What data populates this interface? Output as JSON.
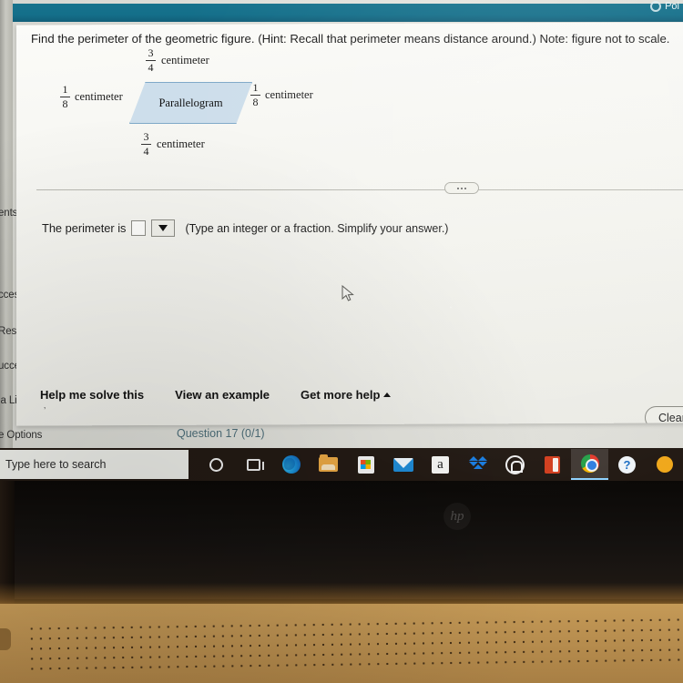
{
  "app": {
    "banner_label": "Poi",
    "banner_color": "#16738d"
  },
  "sidebar": {
    "items": [
      {
        "label": "ents"
      },
      {
        "label": "ccess"
      },
      {
        "label": "Resourc"
      },
      {
        "label": "uccess"
      },
      {
        "label": "ia Library"
      },
      {
        "label": "e Options"
      }
    ]
  },
  "exercise": {
    "prompt": "Find the perimeter of the geometric figure. (Hint: Recall that perimeter means distance around.) Note: figure not to scale.",
    "figure": {
      "shape_label": "Parallelogram",
      "top": {
        "numerator": "3",
        "denominator": "4",
        "unit": "centimeter"
      },
      "bottom": {
        "numerator": "3",
        "denominator": "4",
        "unit": "centimeter"
      },
      "left": {
        "numerator": "1",
        "denominator": "8",
        "unit": "centimeter"
      },
      "right": {
        "numerator": "1",
        "denominator": "8",
        "unit": "centimeter"
      },
      "fill_color": "#cddeeb",
      "border_color": "#7fa9c8"
    },
    "answer": {
      "prefix": "The perimeter is",
      "value": "",
      "unit_value": "",
      "hint": "(Type an integer or a fraction. Simplify your answer.)"
    },
    "links": {
      "help_me_solve": "Help me solve this",
      "view_example": "View an example",
      "get_more_help": "Get more help"
    },
    "clear_button": "Clear a",
    "status": "Question 17 (0/1)"
  },
  "taskbar": {
    "search_placeholder": "Type here to search",
    "icons": [
      {
        "name": "cortana-icon"
      },
      {
        "name": "task-view-icon"
      },
      {
        "name": "edge-icon"
      },
      {
        "name": "file-explorer-icon"
      },
      {
        "name": "microsoft-store-icon"
      },
      {
        "name": "mail-icon"
      },
      {
        "name": "amazon-icon",
        "glyph": "a"
      },
      {
        "name": "dropbox-icon"
      },
      {
        "name": "house-icon"
      },
      {
        "name": "office-icon"
      },
      {
        "name": "chrome-icon"
      },
      {
        "name": "help-icon",
        "glyph": "?"
      },
      {
        "name": "partial-icon"
      }
    ]
  },
  "laptop": {
    "brand": "hp"
  }
}
